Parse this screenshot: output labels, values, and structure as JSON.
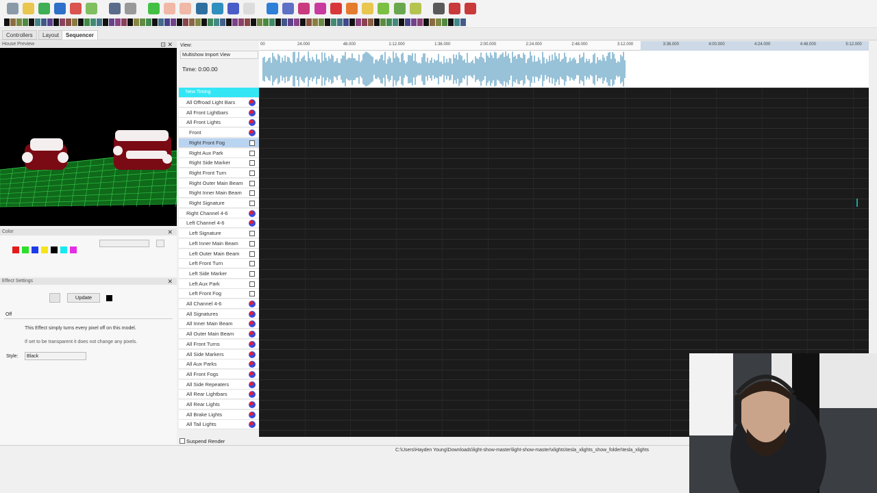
{
  "tabs": [
    "Controllers",
    "Layout",
    "Sequencer"
  ],
  "house_preview": {
    "title": "House Preview"
  },
  "color_panel": {
    "title": "Color"
  },
  "effect_settings": {
    "title": "Effect Settings",
    "update_label": "Update",
    "effect_select": "Off",
    "desc1": "This Effect simply turns every pixel off on this model.",
    "desc2": "If set to be transparent it does not change any pixels.",
    "style_label": "Style:",
    "style_value": "Black"
  },
  "sequencer": {
    "view_label": "View:",
    "view_value": "Multishow Import View",
    "time_label": "Time: 0:00.00",
    "timing_row": "New Timing",
    "ruler": [
      "00",
      "24.000",
      "48.000",
      "1:12.000",
      "1:36.000",
      "2:00.000",
      "2:24.000",
      "2:48.000",
      "3:12.000",
      "3:36.000",
      "4:00.000",
      "4:24.000",
      "4:48.000",
      "5:12.000"
    ],
    "models": [
      {
        "label": "All Offroad Light Bars",
        "type": "group"
      },
      {
        "label": "All Front Lightbars",
        "type": "group"
      },
      {
        "label": "All Front Lights",
        "type": "group"
      },
      {
        "label": "Front",
        "type": "group",
        "indent": true
      },
      {
        "label": "Right Front Fog",
        "type": "model",
        "selected": true
      },
      {
        "label": "Right Aux Park",
        "type": "model"
      },
      {
        "label": "Right Side Marker",
        "type": "model"
      },
      {
        "label": "Right Front Turn",
        "type": "model"
      },
      {
        "label": "Right Outer Main Beam",
        "type": "model"
      },
      {
        "label": "Right Inner Main Beam",
        "type": "model"
      },
      {
        "label": "Right Signature",
        "type": "model"
      },
      {
        "label": "Right Channel 4-6",
        "type": "group"
      },
      {
        "label": "Left Channel 4-6",
        "type": "group"
      },
      {
        "label": "Left Signature",
        "type": "model"
      },
      {
        "label": "Left Inner Main Beam",
        "type": "model"
      },
      {
        "label": "Left Outer Main Beam",
        "type": "model"
      },
      {
        "label": "Left Front Turn",
        "type": "model"
      },
      {
        "label": "Left Side Marker",
        "type": "model"
      },
      {
        "label": "Left Aux Park",
        "type": "model"
      },
      {
        "label": "Left Front Fog",
        "type": "model"
      },
      {
        "label": "All Channel 4-6",
        "type": "group"
      },
      {
        "label": "All Signatures",
        "type": "group"
      },
      {
        "label": "All Inner Main Beam",
        "type": "group"
      },
      {
        "label": "All Outer Main Beam",
        "type": "group"
      },
      {
        "label": "All Front Turns",
        "type": "group"
      },
      {
        "label": "All Side Markers",
        "type": "group"
      },
      {
        "label": "All Aux Parks",
        "type": "group"
      },
      {
        "label": "All Front Fogs",
        "type": "group"
      },
      {
        "label": "All Side Repeaters",
        "type": "group"
      },
      {
        "label": "All Rear Lightbars",
        "type": "group"
      },
      {
        "label": "All Rear Lights",
        "type": "group"
      },
      {
        "label": "All Brake Lights",
        "type": "group"
      },
      {
        "label": "All Tail Lights",
        "type": "group"
      }
    ],
    "suspend_render": "Suspend Render"
  },
  "status_path": "C:\\Users\\Hayden Young\\Downloads\\light-show-master\\light-show-master\\xlights\\tesla_xlights_show_folder\\tesla_xlights",
  "colors": {
    "selected_row": "#b9d4f1",
    "timing_row": "#33e6f5",
    "grid_bg": "#1b1b1b",
    "wave": "#7fb3cf"
  }
}
